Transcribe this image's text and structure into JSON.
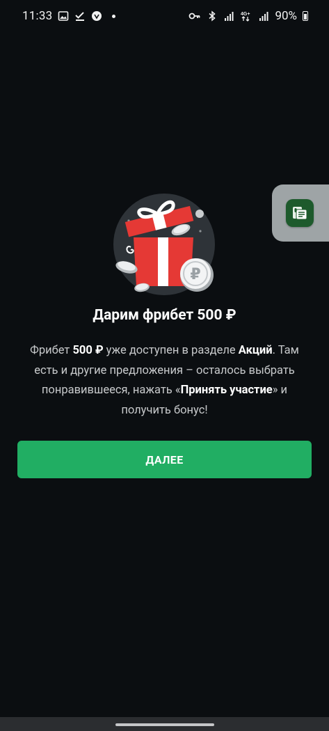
{
  "status_bar": {
    "time": "11:33",
    "battery": "90%"
  },
  "promo": {
    "title": "Дарим фрибет 500 ₽",
    "desc_1": "Фрибет ",
    "desc_amount": "500 ₽",
    "desc_2": " уже доступен в разделе ",
    "desc_section": "Акций",
    "desc_3": ". Там есть и другие предложения – осталось выбрать понравившееся, нажать «",
    "desc_action": "Принять участие",
    "desc_4": "» и получить бонус!",
    "button_label": "ДАЛЕЕ"
  },
  "icons": {
    "gift": "gift-with-coins-icon",
    "side_tab": "voice-recorder-icon"
  },
  "colors": {
    "background": "#0b0e11",
    "accent_green": "#21ae63",
    "gift_red": "#e53935"
  }
}
